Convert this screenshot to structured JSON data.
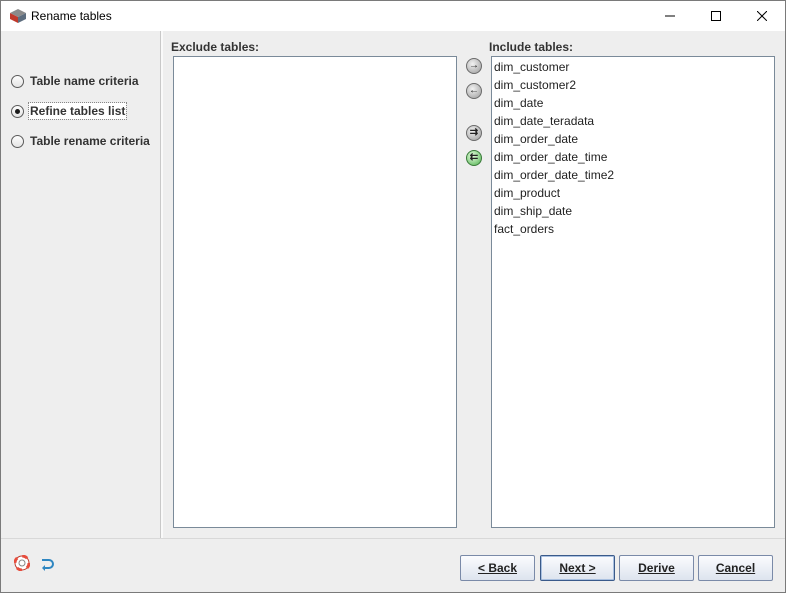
{
  "window": {
    "title": "Rename tables"
  },
  "sidebar": {
    "options": [
      {
        "label": "Table name criteria",
        "checked": false
      },
      {
        "label": "Refine tables list",
        "checked": true
      },
      {
        "label": "Table rename criteria",
        "checked": false
      }
    ]
  },
  "exclude": {
    "label": "Exclude tables:",
    "items": []
  },
  "include": {
    "label": "Include tables:",
    "items": [
      "dim_customer",
      "dim_customer2",
      "dim_date",
      "dim_date_teradata",
      "dim_order_date",
      "dim_order_date_time",
      "dim_order_date_time2",
      "dim_product",
      "dim_ship_date",
      "fact_orders"
    ]
  },
  "move_buttons": {
    "add": "→",
    "remove": "←",
    "add_all": "⇉",
    "remove_all": "⇇"
  },
  "footer": {
    "back": "< Back",
    "next": "Next >",
    "derive": "Derive",
    "cancel": "Cancel"
  },
  "icons": {
    "app": "app-logo-icon",
    "help": "lifebuoy-icon",
    "undo": "undo-icon"
  }
}
